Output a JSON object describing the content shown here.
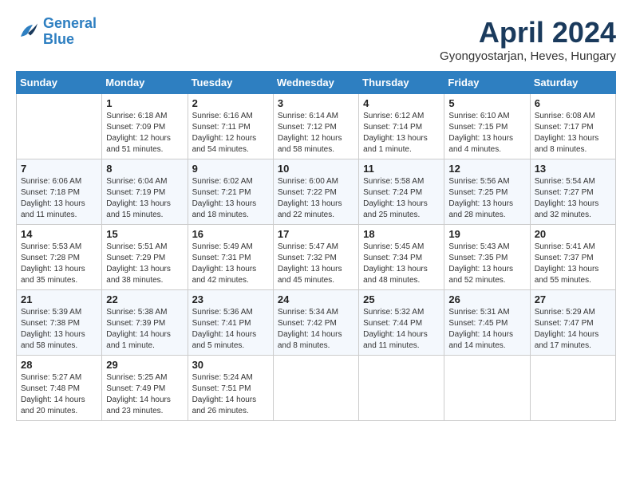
{
  "header": {
    "logo_line1": "General",
    "logo_line2": "Blue",
    "month": "April 2024",
    "location": "Gyongyostarjan, Heves, Hungary"
  },
  "weekdays": [
    "Sunday",
    "Monday",
    "Tuesday",
    "Wednesday",
    "Thursday",
    "Friday",
    "Saturday"
  ],
  "weeks": [
    [
      {
        "day": "",
        "info": ""
      },
      {
        "day": "1",
        "info": "Sunrise: 6:18 AM\nSunset: 7:09 PM\nDaylight: 12 hours\nand 51 minutes."
      },
      {
        "day": "2",
        "info": "Sunrise: 6:16 AM\nSunset: 7:11 PM\nDaylight: 12 hours\nand 54 minutes."
      },
      {
        "day": "3",
        "info": "Sunrise: 6:14 AM\nSunset: 7:12 PM\nDaylight: 12 hours\nand 58 minutes."
      },
      {
        "day": "4",
        "info": "Sunrise: 6:12 AM\nSunset: 7:14 PM\nDaylight: 13 hours\nand 1 minute."
      },
      {
        "day": "5",
        "info": "Sunrise: 6:10 AM\nSunset: 7:15 PM\nDaylight: 13 hours\nand 4 minutes."
      },
      {
        "day": "6",
        "info": "Sunrise: 6:08 AM\nSunset: 7:17 PM\nDaylight: 13 hours\nand 8 minutes."
      }
    ],
    [
      {
        "day": "7",
        "info": "Sunrise: 6:06 AM\nSunset: 7:18 PM\nDaylight: 13 hours\nand 11 minutes."
      },
      {
        "day": "8",
        "info": "Sunrise: 6:04 AM\nSunset: 7:19 PM\nDaylight: 13 hours\nand 15 minutes."
      },
      {
        "day": "9",
        "info": "Sunrise: 6:02 AM\nSunset: 7:21 PM\nDaylight: 13 hours\nand 18 minutes."
      },
      {
        "day": "10",
        "info": "Sunrise: 6:00 AM\nSunset: 7:22 PM\nDaylight: 13 hours\nand 22 minutes."
      },
      {
        "day": "11",
        "info": "Sunrise: 5:58 AM\nSunset: 7:24 PM\nDaylight: 13 hours\nand 25 minutes."
      },
      {
        "day": "12",
        "info": "Sunrise: 5:56 AM\nSunset: 7:25 PM\nDaylight: 13 hours\nand 28 minutes."
      },
      {
        "day": "13",
        "info": "Sunrise: 5:54 AM\nSunset: 7:27 PM\nDaylight: 13 hours\nand 32 minutes."
      }
    ],
    [
      {
        "day": "14",
        "info": "Sunrise: 5:53 AM\nSunset: 7:28 PM\nDaylight: 13 hours\nand 35 minutes."
      },
      {
        "day": "15",
        "info": "Sunrise: 5:51 AM\nSunset: 7:29 PM\nDaylight: 13 hours\nand 38 minutes."
      },
      {
        "day": "16",
        "info": "Sunrise: 5:49 AM\nSunset: 7:31 PM\nDaylight: 13 hours\nand 42 minutes."
      },
      {
        "day": "17",
        "info": "Sunrise: 5:47 AM\nSunset: 7:32 PM\nDaylight: 13 hours\nand 45 minutes."
      },
      {
        "day": "18",
        "info": "Sunrise: 5:45 AM\nSunset: 7:34 PM\nDaylight: 13 hours\nand 48 minutes."
      },
      {
        "day": "19",
        "info": "Sunrise: 5:43 AM\nSunset: 7:35 PM\nDaylight: 13 hours\nand 52 minutes."
      },
      {
        "day": "20",
        "info": "Sunrise: 5:41 AM\nSunset: 7:37 PM\nDaylight: 13 hours\nand 55 minutes."
      }
    ],
    [
      {
        "day": "21",
        "info": "Sunrise: 5:39 AM\nSunset: 7:38 PM\nDaylight: 13 hours\nand 58 minutes."
      },
      {
        "day": "22",
        "info": "Sunrise: 5:38 AM\nSunset: 7:39 PM\nDaylight: 14 hours\nand 1 minute."
      },
      {
        "day": "23",
        "info": "Sunrise: 5:36 AM\nSunset: 7:41 PM\nDaylight: 14 hours\nand 5 minutes."
      },
      {
        "day": "24",
        "info": "Sunrise: 5:34 AM\nSunset: 7:42 PM\nDaylight: 14 hours\nand 8 minutes."
      },
      {
        "day": "25",
        "info": "Sunrise: 5:32 AM\nSunset: 7:44 PM\nDaylight: 14 hours\nand 11 minutes."
      },
      {
        "day": "26",
        "info": "Sunrise: 5:31 AM\nSunset: 7:45 PM\nDaylight: 14 hours\nand 14 minutes."
      },
      {
        "day": "27",
        "info": "Sunrise: 5:29 AM\nSunset: 7:47 PM\nDaylight: 14 hours\nand 17 minutes."
      }
    ],
    [
      {
        "day": "28",
        "info": "Sunrise: 5:27 AM\nSunset: 7:48 PM\nDaylight: 14 hours\nand 20 minutes."
      },
      {
        "day": "29",
        "info": "Sunrise: 5:25 AM\nSunset: 7:49 PM\nDaylight: 14 hours\nand 23 minutes."
      },
      {
        "day": "30",
        "info": "Sunrise: 5:24 AM\nSunset: 7:51 PM\nDaylight: 14 hours\nand 26 minutes."
      },
      {
        "day": "",
        "info": ""
      },
      {
        "day": "",
        "info": ""
      },
      {
        "day": "",
        "info": ""
      },
      {
        "day": "",
        "info": ""
      }
    ]
  ]
}
